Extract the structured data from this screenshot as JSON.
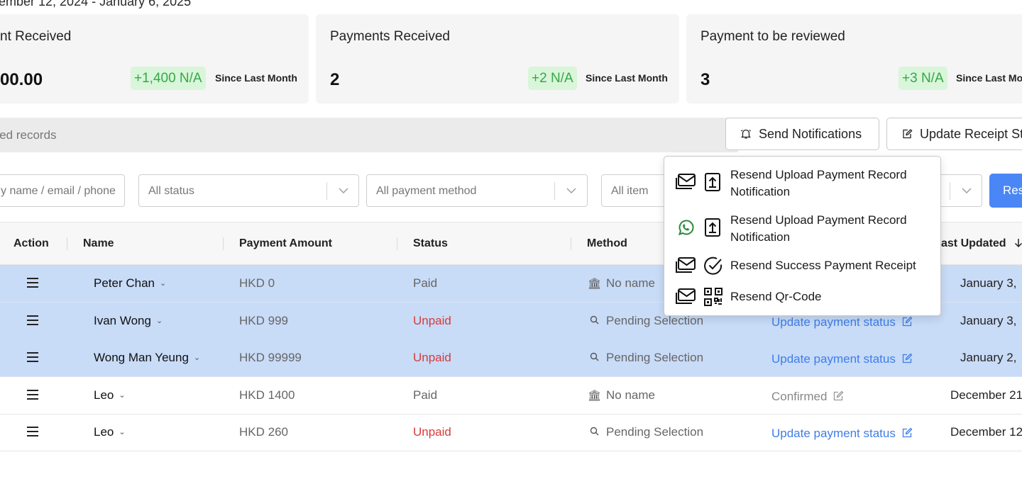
{
  "date_range": "ember 12, 2024 - January 6, 2025",
  "cards": [
    {
      "title": "nt Received",
      "value": "00.00",
      "delta": "+1,400 N/A",
      "since": "Since Last Month"
    },
    {
      "title": "Payments Received",
      "value": "2",
      "delta": "+2 N/A",
      "since": "Since Last Month"
    },
    {
      "title": "Payment to be reviewed",
      "value": "3",
      "delta": "+3 N/A",
      "since": "Since Last Mor"
    }
  ],
  "selection_bar": {
    "text": "cted records"
  },
  "toolbar": {
    "send_notifications": "Send Notifications",
    "update_receipt": "Update Receipt St"
  },
  "filters": {
    "search_placeholder": "y name / email / phone",
    "status": "All status",
    "payment_method": "All payment method",
    "item": "All item",
    "reset_label": "Res"
  },
  "table": {
    "headers": {
      "action": "Action",
      "name": "Name",
      "amount": "Payment Amount",
      "status": "Status",
      "method": "Method",
      "last_updated": "ast Updated"
    },
    "rows": [
      {
        "name": "Peter Chan",
        "amount": "HKD 0",
        "status": "Paid",
        "method": "No name",
        "method_icon": "bank-icon",
        "review": "",
        "date": "January 3,",
        "selected": true
      },
      {
        "name": "Ivan Wong",
        "amount": "HKD 999",
        "status": "Unpaid",
        "method": "Pending Selection",
        "method_icon": "search-icon",
        "review": "Update payment status",
        "date": "January 3,",
        "selected": true
      },
      {
        "name": "Wong Man Yeung",
        "amount": "HKD 99999",
        "status": "Unpaid",
        "method": "Pending Selection",
        "method_icon": "search-icon",
        "review": "Update payment status",
        "date": "January 2,",
        "selected": true
      },
      {
        "name": "Leo",
        "amount": "HKD 1400",
        "status": "Paid",
        "method": "No name",
        "method_icon": "bank-icon",
        "review": "Confirmed",
        "date": "December 21",
        "selected": false
      },
      {
        "name": "Leo",
        "amount": "HKD 260",
        "status": "Unpaid",
        "method": "Pending Selection",
        "method_icon": "search-icon",
        "review": "Update payment status",
        "date": "December 12",
        "selected": false
      }
    ]
  },
  "notification_menu": {
    "items": [
      {
        "channel_icon": "email-icon",
        "action_icon": "upload-icon",
        "label": "Resend Upload Payment Record Notification"
      },
      {
        "channel_icon": "whatsapp-icon",
        "action_icon": "upload-icon",
        "label": "Resend Upload Payment Record Notification"
      },
      {
        "channel_icon": "email-icon",
        "action_icon": "check-circle-icon",
        "label": "Resend Success Payment Receipt"
      },
      {
        "channel_icon": "email-icon",
        "action_icon": "qr-code-icon",
        "label": "Resend Qr-Code"
      }
    ]
  },
  "colors": {
    "accent": "#4a86f5",
    "selected_row": "#c8dbf7",
    "unpaid": "#d83b3b",
    "link": "#3f7de8",
    "delta_bg": "#d9f5da",
    "delta_text": "#35a846"
  }
}
